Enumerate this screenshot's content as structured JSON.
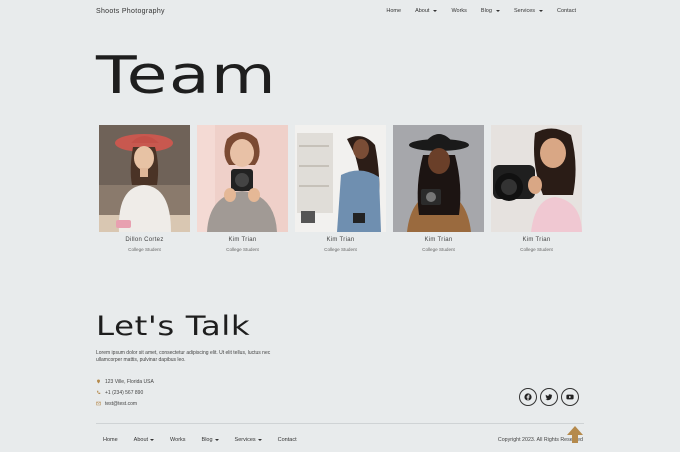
{
  "header": {
    "brand": "Shoots Photography",
    "nav": [
      {
        "label": "Home",
        "caret": false
      },
      {
        "label": "About",
        "caret": true
      },
      {
        "label": "Works",
        "caret": false
      },
      {
        "label": "Blog",
        "caret": true
      },
      {
        "label": "Services",
        "caret": true
      },
      {
        "label": "Contact",
        "caret": false
      }
    ]
  },
  "team": {
    "title": "Team",
    "members": [
      {
        "name": "Dillon Cortez",
        "role": "College Student"
      },
      {
        "name": "Kim Trian",
        "role": "College Student"
      },
      {
        "name": "Kim Trian",
        "role": "College Student"
      },
      {
        "name": "Kim Trian",
        "role": "College Student"
      },
      {
        "name": "Kim Trian",
        "role": "College Student"
      }
    ]
  },
  "talk": {
    "title": "Let's Talk",
    "body": "Lorem ipsum dolor sit amet, consectetur adipiscing elit. Ut elit tellus, luctus nec ullamcorper mattis, pulvinar dapibus leo.",
    "address": "123 Ville, Florida USA",
    "phone": "+1 (234) 567 890",
    "email": "test@test.com"
  },
  "socials": [
    "facebook-icon",
    "twitter-icon",
    "youtube-icon"
  ],
  "footer": {
    "nav": [
      {
        "label": "Home",
        "caret": false
      },
      {
        "label": "About",
        "caret": true
      },
      {
        "label": "Works",
        "caret": false
      },
      {
        "label": "Blog",
        "caret": true
      },
      {
        "label": "Services",
        "caret": true
      },
      {
        "label": "Contact",
        "caret": false
      }
    ],
    "copyright": "Copyright 2023. All Rights Reserved"
  },
  "colors": {
    "background": "#e8ebec",
    "accent": "#b58a4c",
    "text": "#222222"
  }
}
